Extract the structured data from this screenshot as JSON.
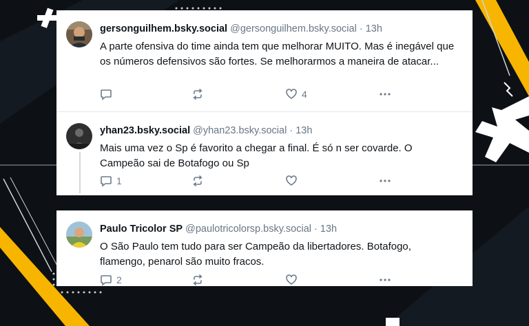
{
  "posts": [
    {
      "display_name": "gersonguilhem.bsky.social",
      "handle": "@gersonguilhem.bsky.social",
      "time": "13h",
      "text": "A parte ofensiva do time ainda tem que melhorar MUITO. Mas é inegável que os números defensivos são fortes. Se melhorarmos a maneira de atacar...",
      "reply_count": "",
      "like_count": "4"
    },
    {
      "display_name": "yhan23.bsky.social",
      "handle": "@yhan23.bsky.social",
      "time": "13h",
      "text": "Mais uma vez o Sp é favorito a chegar a final. É só n ser covarde. O Campeão sai de Botafogo ou Sp",
      "reply_count": "1",
      "like_count": ""
    },
    {
      "display_name": "Paulo Tricolor SP",
      "handle": "@paulotricolorsp.bsky.social",
      "time": "13h",
      "text": "O São Paulo tem tudo para ser Campeão da libertadores. Botafogo, flamengo,  penarol são muito fracos.",
      "reply_count": "2",
      "like_count": ""
    }
  ],
  "separator": "·",
  "icons": {
    "reply": "reply-icon",
    "repost": "repost-icon",
    "like": "heart-icon",
    "more": "more-icon"
  },
  "colors": {
    "accent_yellow": "#f7b500",
    "background": "#0d1014",
    "card": "#ffffff",
    "muted": "#687684"
  }
}
